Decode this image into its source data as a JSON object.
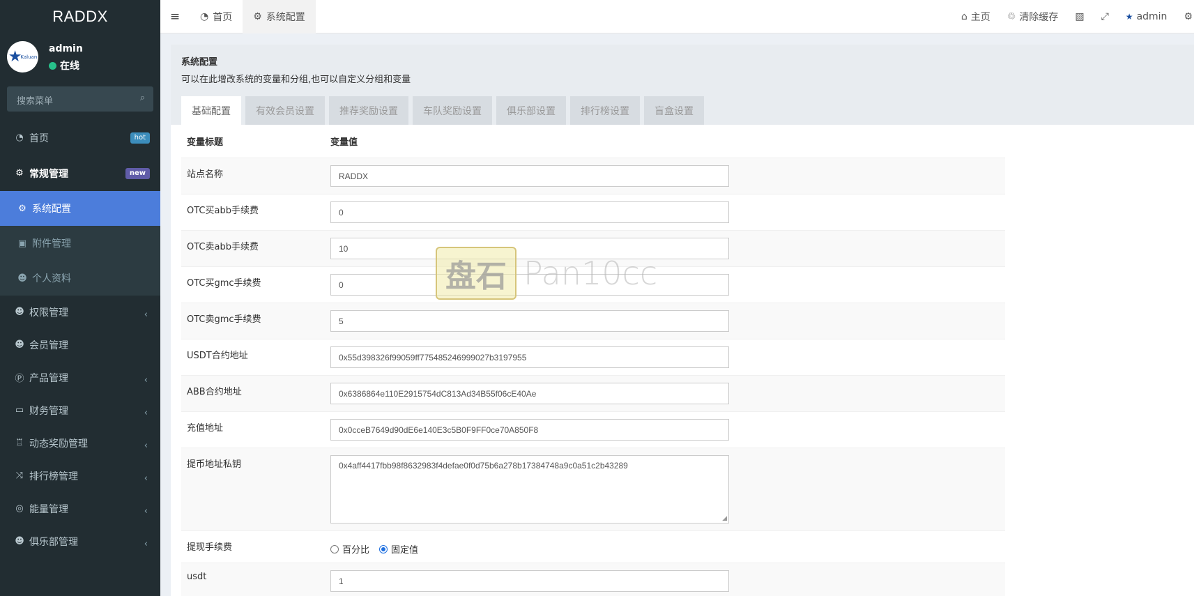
{
  "sidebar": {
    "logo": "RADDX",
    "avatar_brand": "Kaluan",
    "user_name": "admin",
    "user_status": "在线",
    "search_placeholder": "搜索菜单",
    "menu": [
      {
        "label": "首页",
        "icon": "dashboard-icon",
        "badge": "hot"
      },
      {
        "label": "常规管理",
        "icon": "cogs-icon",
        "badge": "new"
      },
      {
        "label": "系统配置",
        "icon": "gear-icon"
      },
      {
        "label": "附件管理",
        "icon": "image-icon"
      },
      {
        "label": "个人资料",
        "icon": "user-icon"
      },
      {
        "label": "权限管理",
        "icon": "group-icon"
      },
      {
        "label": "会员管理",
        "icon": "user-icon"
      },
      {
        "label": "产品管理",
        "icon": "product-icon"
      },
      {
        "label": "财务管理",
        "icon": "credit-card-icon"
      },
      {
        "label": "动态奖励管理",
        "icon": "trophy-icon"
      },
      {
        "label": "排行榜管理",
        "icon": "random-icon"
      },
      {
        "label": "能量管理",
        "icon": "life-ring-icon"
      },
      {
        "label": "俱乐部管理",
        "icon": "group-icon"
      }
    ]
  },
  "header": {
    "tabs": [
      {
        "label": "首页",
        "icon": "dashboard-icon"
      },
      {
        "label": "系统配置",
        "icon": "gear-icon"
      }
    ],
    "right": {
      "home": "主页",
      "clear_cache": "清除缓存",
      "user": "admin"
    }
  },
  "panel": {
    "title": "系统配置",
    "description": "可以在此增改系统的变量和分组,也可以自定义分组和变量",
    "tabs": [
      "基础配置",
      "有效会员设置",
      "推荐奖励设置",
      "车队奖励设置",
      "俱乐部设置",
      "排行榜设置",
      "盲盒设置"
    ],
    "table": {
      "col_title": "变量标题",
      "col_value": "变量值",
      "rows": [
        {
          "label": "站点名称",
          "value": "RADDX"
        },
        {
          "label": "OTC买abb手续费",
          "value": "0"
        },
        {
          "label": "OTC卖abb手续费",
          "value": "10"
        },
        {
          "label": "OTC买gmc手续费",
          "value": "0"
        },
        {
          "label": "OTC卖gmc手续费",
          "value": "5"
        },
        {
          "label": "USDT合约地址",
          "value": "0x55d398326f99059ff775485246999027b3197955"
        },
        {
          "label": "ABB合约地址",
          "value": "0x6386864e110E2915754dC813Ad34B55f06cE40Ae"
        },
        {
          "label": "充值地址",
          "value": "0x0cceB7649d90dE6e140E3c5B0F9FF0ce70A850F8"
        },
        {
          "label": "提币地址私钥",
          "value": "0x4aff4417fbb98f8632983f4defae0f0d75b6a278b17384748a9c0a51c2b43289"
        },
        {
          "label": "提现手续费",
          "options": [
            "百分比",
            "固定值"
          ],
          "selected": "固定值"
        },
        {
          "label": "usdt",
          "value": "1"
        }
      ]
    }
  },
  "watermark": {
    "glyphs": "盘石",
    "text": "Pan10cc"
  },
  "colors": {
    "sidebar_bg": "#222d32",
    "active_item": "#4c7ddb",
    "hot_badge": "#3c8dbc",
    "new_badge": "#605ca8",
    "online_dot": "#27c08a"
  }
}
